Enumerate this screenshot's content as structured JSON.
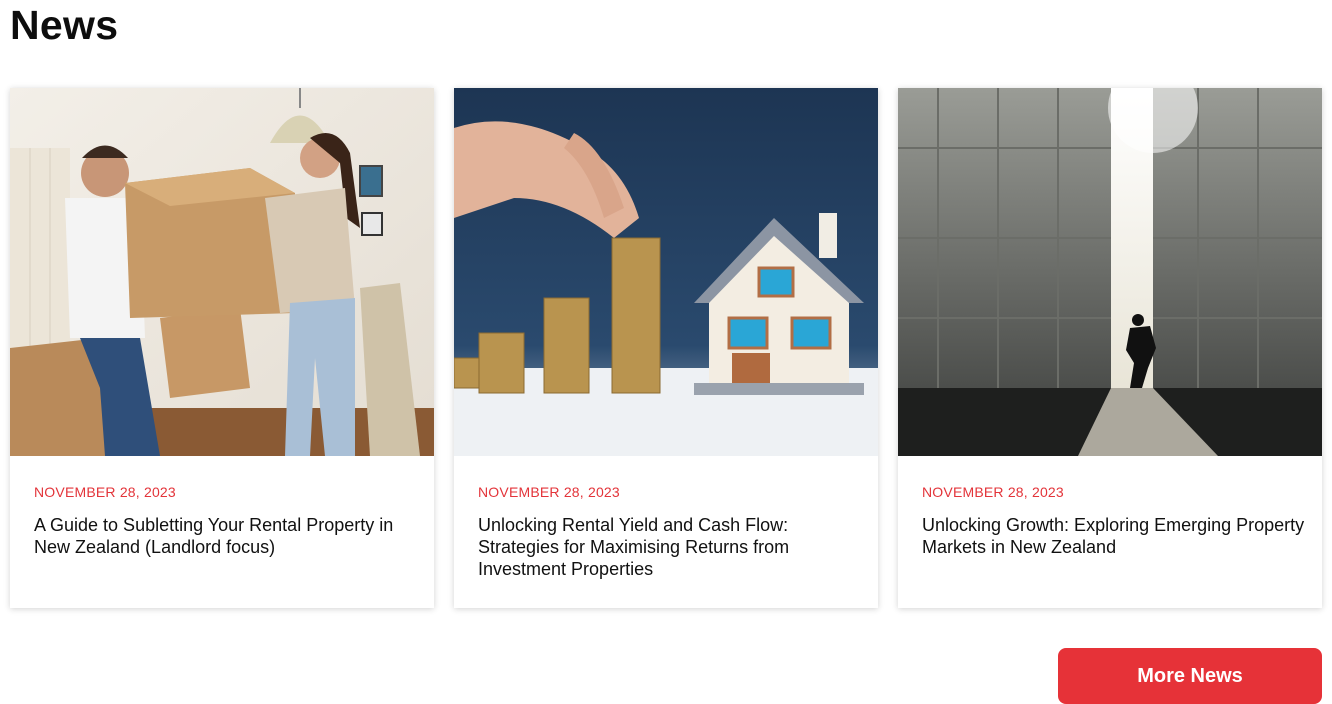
{
  "section": {
    "title": "News"
  },
  "articles": [
    {
      "date": "NOVEMBER 28, 2023",
      "title": "A Guide to Subletting Your Rental Property in New Zealand (Landlord focus)",
      "image": "couple-moving-boxes-photo"
    },
    {
      "date": "NOVEMBER 28, 2023",
      "title": "Unlocking Rental Yield and Cash Flow: Strategies for Maximising Returns from Investment Properties",
      "image": "coins-and-house-model-photo"
    },
    {
      "date": "NOVEMBER 28, 2023",
      "title": "Unlocking Growth: Exploring Emerging Property Markets in New Zealand",
      "image": "man-opening-hangar-door-photo"
    }
  ],
  "more_button": {
    "label": "More News"
  },
  "colors": {
    "accent": "#e63238",
    "date": "#e3343a"
  }
}
